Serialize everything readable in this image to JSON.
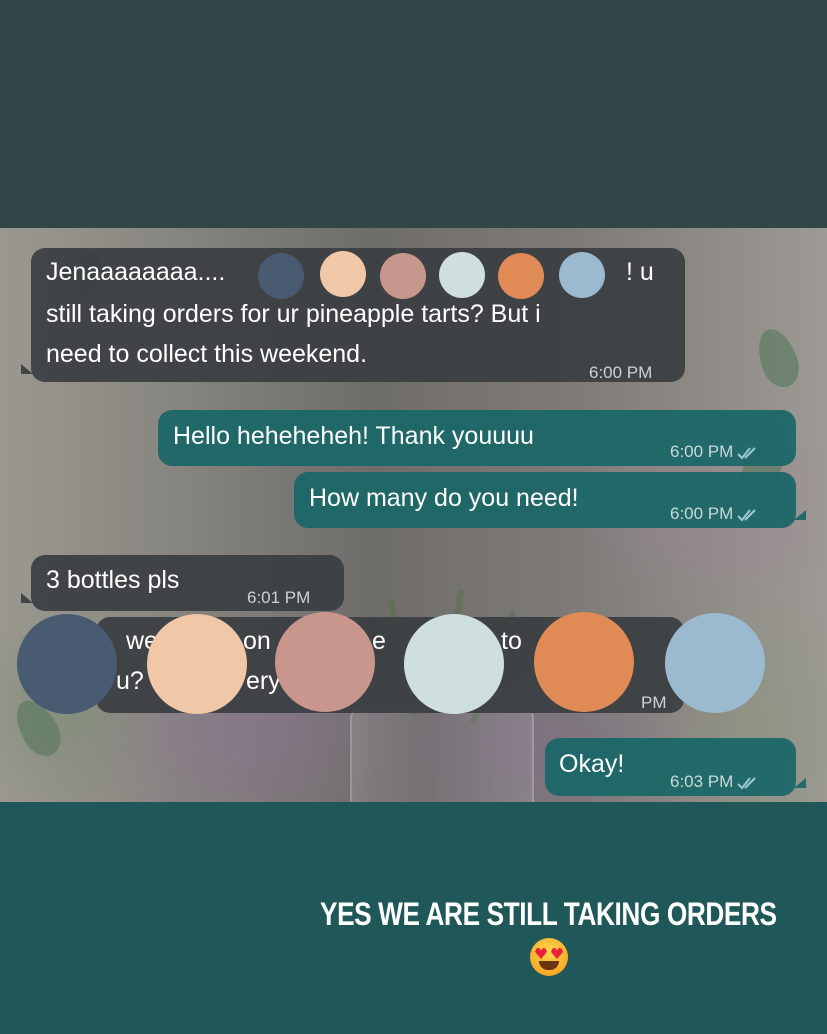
{
  "messages": [
    {
      "id": "m1",
      "direction": "incoming",
      "lines": [
        "Jenaaaaaaaa....",
        "still taking orders for ur pineapple tarts? But i",
        "need to collect this weekend."
      ],
      "line1_tail": "! u",
      "time": "6:00 PM"
    },
    {
      "id": "m2",
      "direction": "outgoing",
      "text": "Hello heheheheh! Thank youuuu",
      "time": "6:00 PM"
    },
    {
      "id": "m3",
      "direction": "outgoing",
      "text": "How many do you need!",
      "time": "6:00 PM"
    },
    {
      "id": "m4",
      "direction": "incoming",
      "text": "3 bottles pls",
      "time": "6:01 PM"
    },
    {
      "id": "m5",
      "direction": "outgoing",
      "fragments": [
        "we",
        "u?",
        "on",
        "ery",
        "e",
        "to"
      ],
      "time_fragment": "PM"
    },
    {
      "id": "m6",
      "direction": "outgoing",
      "text": "Okay!",
      "time": "6:03 PM"
    }
  ],
  "redaction_colors": [
    "#485b70",
    "#f0c8a8",
    "#c9968e",
    "#cfdfdf",
    "#e08a55",
    "#9bbad0"
  ],
  "caption": {
    "text": "YES WE ARE STILL TAKING ORDERS",
    "emoji": "heart-eyes-emoji"
  },
  "colors": {
    "top_background": "#344547",
    "bottom_background": "#20585a",
    "incoming_bubble": "#3a3e41",
    "outgoing_bubble": "#1a6667",
    "read_ticks": "#9cc8d8"
  }
}
